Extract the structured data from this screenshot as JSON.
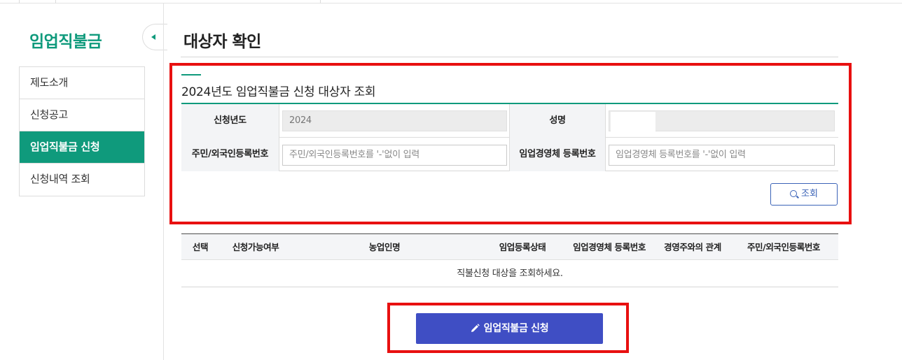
{
  "sidebar": {
    "title": "임업직불금",
    "items": [
      {
        "label": "제도소개",
        "active": false
      },
      {
        "label": "신청공고",
        "active": false
      },
      {
        "label": "임업직불금 신청",
        "active": true
      },
      {
        "label": "신청내역 조회",
        "active": false
      }
    ]
  },
  "page": {
    "title": "대상자 확인"
  },
  "lookup": {
    "title": "2024년도 임업직불금 신청 대상자 조회",
    "year_label": "신청년도",
    "year_value": "2024",
    "name_label": "성명",
    "name_value": "",
    "rrn_label": "주민/외국인등록번호",
    "rrn_placeholder": "주민/외국인등록번호를 '-'없이 입력",
    "biz_label": "임업경영체 등록번호",
    "biz_placeholder": "임업경영체 등록번호를 '-'없이 입력",
    "search_label": "조회"
  },
  "results": {
    "columns": [
      "선택",
      "신청가능여부",
      "농업인명",
      "임업등록상태",
      "임업경영체 등록번호",
      "경영주와의 관계",
      "주민/외국인등록번호"
    ],
    "empty_message": "직불신청 대상을 조회하세요."
  },
  "apply_button": {
    "label": "임업직불금 신청"
  },
  "colors": {
    "brand_green": "#0f9a7c",
    "apply_blue": "#3f4ec4",
    "search_blue": "#3b63b7",
    "highlight_red": "#e81010"
  }
}
